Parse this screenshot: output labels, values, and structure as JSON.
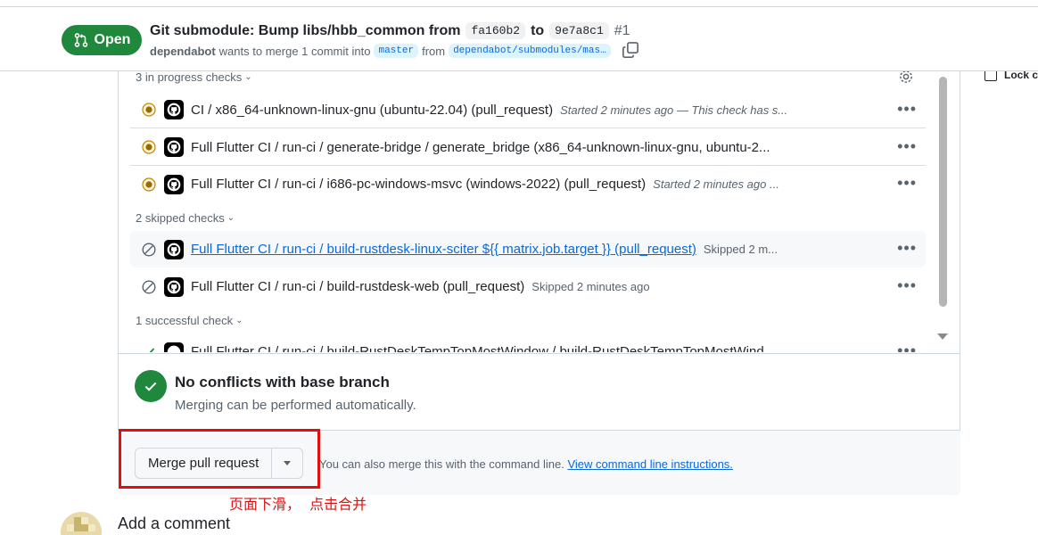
{
  "header": {
    "state": "Open",
    "title": "Git submodule: Bump libs/hbb_common from",
    "sha_from": "fa160b2",
    "to_word": "to",
    "sha_to": "9e7a8c1",
    "number": "#1",
    "author": "dependabot",
    "merge_text": "wants to merge 1 commit into",
    "base_branch": "master",
    "from_word": "from",
    "head_branch": "dependabot/submodules/mas…"
  },
  "sidebar": {
    "lock_label": "Lock c"
  },
  "checks": {
    "in_progress_header": "3 in progress checks",
    "skipped_header": "2 skipped checks",
    "successful_header": "1 successful check",
    "in_progress": [
      {
        "name": "CI / x86_64-unknown-linux-gnu (ubuntu-22.04) (pull_request)",
        "meta": "Started 2 minutes ago — This check has s..."
      },
      {
        "name": "Full Flutter CI / run-ci / generate-bridge / generate_bridge (x86_64-unknown-linux-gnu, ubuntu-2...",
        "meta": ""
      },
      {
        "name": "Full Flutter CI / run-ci / i686-pc-windows-msvc (windows-2022) (pull_request)",
        "meta": "Started 2 minutes ago ..."
      }
    ],
    "skipped": [
      {
        "name": "Full Flutter CI / run-ci / build-rustdesk-linux-sciter ${{ matrix.job.target }} (pull_request)",
        "meta": "Skipped 2 m..."
      },
      {
        "name": "Full Flutter CI / run-ci / build-rustdesk-web (pull_request)",
        "meta": "Skipped 2 minutes ago"
      }
    ],
    "successful": [
      {
        "name": "Full Flutter CI / run-ci / build-RustDeskTempTopMostWindow / build-RustDeskTempTopMostWind..."
      }
    ]
  },
  "conflicts": {
    "title": "No conflicts with base branch",
    "subtitle": "Merging can be performed automatically."
  },
  "merge": {
    "button_label": "Merge pull request",
    "alt_text": "You can also merge this with the command line.",
    "alt_link": "View command line instructions."
  },
  "annotation": "页面下滑，  点击合并",
  "comment": {
    "heading": "Add a comment"
  },
  "colors": {
    "open_green": "#1f883d",
    "link_blue": "#0969da",
    "annotation_red": "#e01010",
    "pending_amber": "#bf8700"
  }
}
